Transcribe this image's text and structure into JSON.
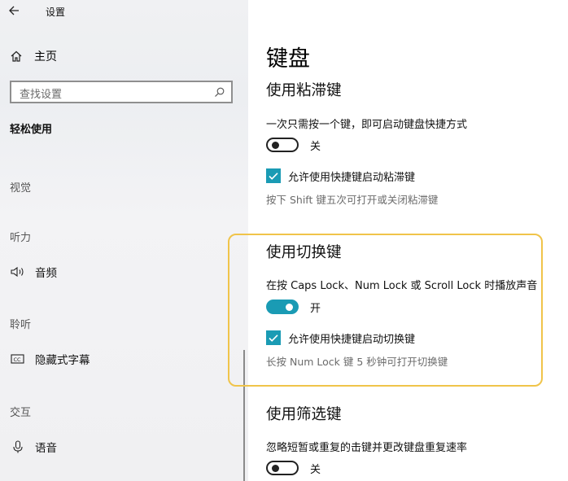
{
  "window": {
    "title": "设置"
  },
  "sidebar": {
    "home_label": "主页",
    "search_placeholder": "查找设置",
    "section_title": "轻松使用",
    "groups": [
      {
        "label": "视觉"
      },
      {
        "label": "听力",
        "items": [
          {
            "label": "音频",
            "icon": "speaker-icon"
          },
          {
            "label": "隐藏式字幕",
            "icon": "closed-caption-icon"
          }
        ]
      },
      {
        "label": "交互",
        "items": [
          {
            "label": "语音",
            "icon": "microphone-icon"
          }
        ]
      }
    ],
    "extra": [
      {
        "label": "聆听"
      }
    ]
  },
  "main": {
    "page_title": "键盘",
    "sticky": {
      "heading": "使用粘滞键",
      "description": "一次只需按一个键，即可启动键盘快捷方式",
      "toggle_state": "关",
      "checkbox_label": "允许使用快捷键启动粘滞键",
      "hint": "按下 Shift 键五次可打开或关闭粘滞键"
    },
    "toggle_keys": {
      "heading": "使用切换键",
      "description": "在按 Caps Lock、Num Lock 或 Scroll Lock 时播放声音",
      "toggle_state": "开",
      "checkbox_label": "允许使用快捷键启动切换键",
      "hint": "长按 Num Lock 键 5 秒钟可打开切换键"
    },
    "filter": {
      "heading": "使用筛选键",
      "description": "忽略短暂或重复的击键并更改键盘重复速率",
      "toggle_state": "关"
    }
  },
  "colors": {
    "accent": "#1a9bb4",
    "highlight": "#f0c44a"
  }
}
